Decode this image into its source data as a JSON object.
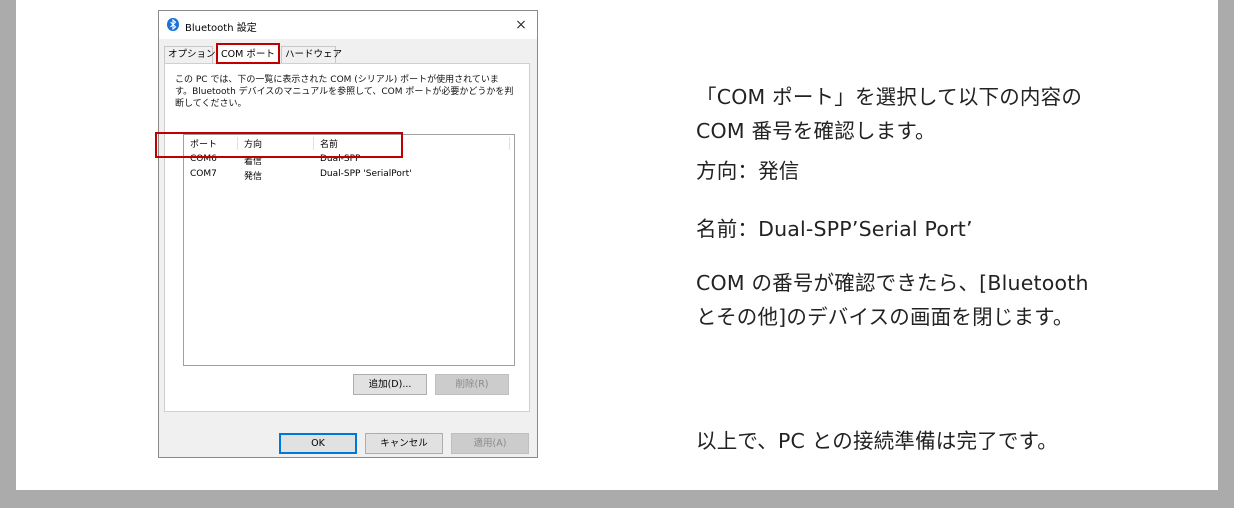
{
  "dialog": {
    "title": "Bluetooth 設定",
    "close_label": "×",
    "tabs": [
      {
        "label": "オプション",
        "active": false
      },
      {
        "label": "COM ポート",
        "active": true
      },
      {
        "label": "ハードウェア",
        "active": false
      }
    ],
    "description_lines": [
      "この PC では、下の一覧に表示された COM (シリアル) ポートが使用されていま",
      "す。Bluetooth デバイスのマニュアルを参照して、COM ポートが必要かどうかを判",
      "断してください。"
    ],
    "list": {
      "columns": [
        "ポート",
        "方向",
        "名前"
      ],
      "rows": [
        {
          "port": "COM6",
          "direction": "着信",
          "name": "Dual-SPP"
        },
        {
          "port": "COM7",
          "direction": "発信",
          "name": "Dual-SPP 'SerialPort'"
        }
      ]
    },
    "add_button": "追加(D)...",
    "remove_button": "削除(R)",
    "ok_button": "OK",
    "cancel_button": "キャンセル",
    "apply_button": "適用(A)"
  },
  "instructions": {
    "p1_line1": "「COM ポート」を選択して以下の内容の",
    "p1_line2": "COM 番号を確認します。",
    "direction": "方向：発信",
    "name": "名前：Dual-SPP’Serial Port’",
    "p4_line1": "COM の番号が確認できたら、[Bluetooth",
    "p4_line2": "とその他]のデバイスの画面を閉じます。",
    "p5": "以上で、PC との接続準備は完了です。"
  },
  "colors": {
    "highlight_red": "#c00000",
    "bluetooth_blue": "#1a73d9",
    "primary_button_border": "#0078d7",
    "frame_gray": "#ababab"
  }
}
